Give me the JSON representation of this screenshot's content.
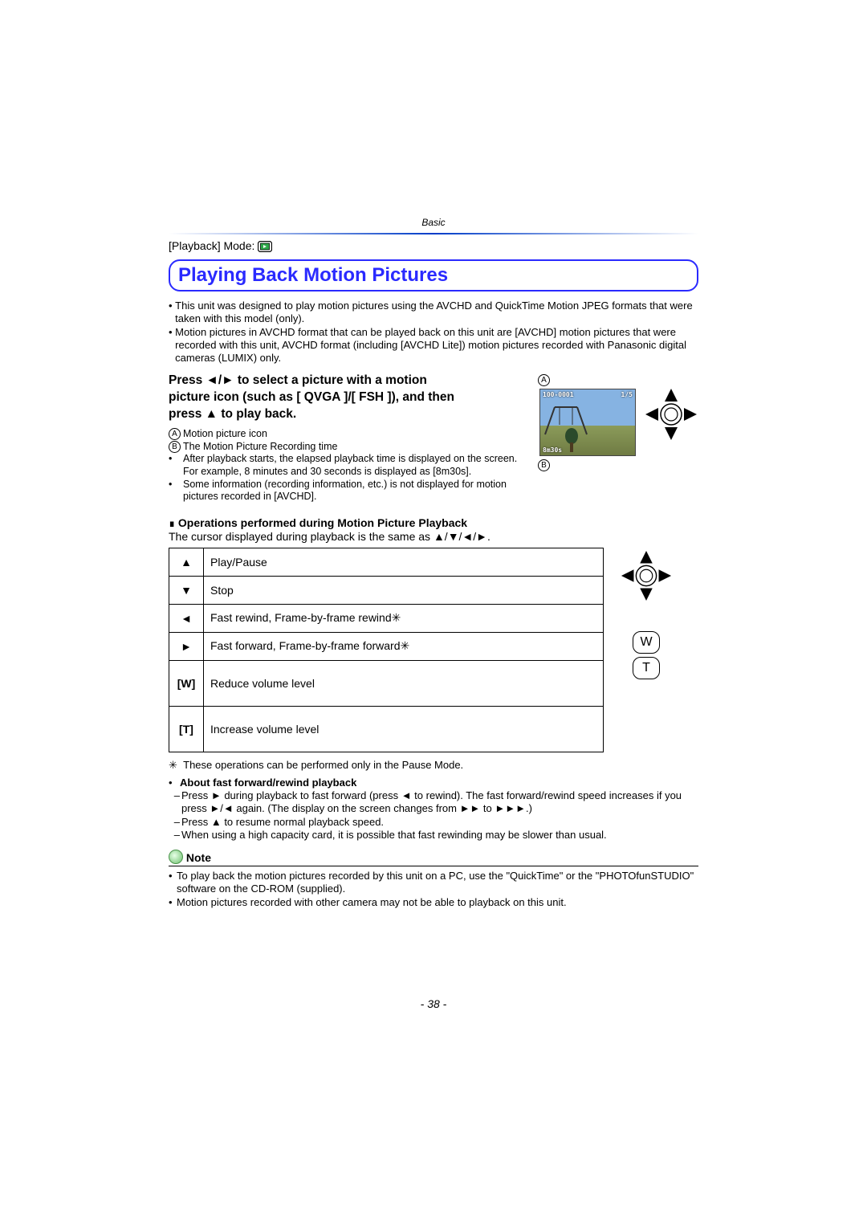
{
  "section_label": "Basic",
  "mode_line_prefix": "[Playback] Mode: ",
  "title": "Playing Back Motion Pictures",
  "intro_bullets": [
    "This unit was designed to play motion pictures using the AVCHD and QuickTime Motion JPEG formats that were taken with this model (only).",
    "Motion pictures in AVCHD format that can be played back on this unit are [AVCHD] motion pictures that were recorded with this unit, AVCHD format (including [AVCHD Lite]) motion pictures recorded with Panasonic digital cameras (LUMIX) only."
  ],
  "instruction_lines": [
    "Press ◄/► to select a picture with a motion",
    "picture icon (such as [ QVGA ]/[ FSH ]), and then",
    "press ▲ to play back."
  ],
  "label_A": "A",
  "label_B": "B",
  "thumb_text_topright": "1/5",
  "thumb_text_topleft": "100-0001",
  "thumb_text_duration": "8m30s",
  "desc_A": "Motion picture icon",
  "desc_B": "The Motion Picture Recording time",
  "desc_bullets": [
    "After playback starts, the elapsed playback time is displayed on the screen.",
    "For example, 8 minutes and 30 seconds is displayed as [8m30s].",
    "Some information (recording information, etc.) is not displayed for motion pictures recorded in [AVCHD]."
  ],
  "ops_header": "Operations performed during Motion Picture Playback",
  "ops_intro": "The cursor displayed during playback is the same as ▲/▼/◄/►.",
  "ops_rows": [
    {
      "sym": "▲",
      "label": "Play/Pause"
    },
    {
      "sym": "▼",
      "label": "Stop"
    },
    {
      "sym": "◄",
      "label": "Fast rewind, Frame-by-frame rewind✳"
    },
    {
      "sym": "►",
      "label": "Fast forward, Frame-by-frame forward✳"
    },
    {
      "sym": "[W]",
      "label": "Reduce volume level"
    },
    {
      "sym": "[T]",
      "label": "Increase volume level"
    }
  ],
  "buttons": {
    "w": "W",
    "t": "T"
  },
  "star_footnote": "These operations can be performed only in the Pause Mode.",
  "about_header": "About fast forward/rewind playback",
  "about_rows": [
    "Press ► during playback to fast forward (press ◄ to rewind). The fast forward/rewind speed increases if you press ►/◄ again. (The display on the screen changes from ►► to ►►►.)",
    "Press ▲ to resume normal playback speed.",
    "When using a high capacity card, it is possible that fast rewinding may be slower than usual."
  ],
  "note_label": "Note",
  "note_rows": [
    "To play back the motion pictures recorded by this unit on a PC, use the \"QuickTime\" or the \"PHOTOfunSTUDIO\" software on the CD-ROM (supplied).",
    "Motion pictures recorded with other camera may not be able to playback on this unit."
  ],
  "page_number": "- 38 -"
}
